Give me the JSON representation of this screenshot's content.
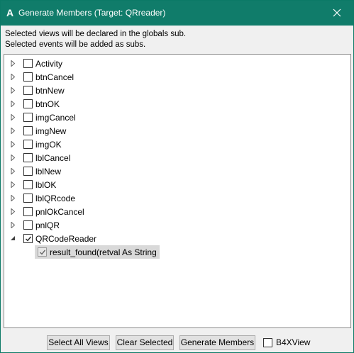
{
  "window": {
    "title": "Generate Members (Target: QRreader)",
    "icon_letter": "A",
    "titlebar_color": "#107c6a"
  },
  "description": {
    "line1": "Selected views will be declared in the globals sub.",
    "line2": "Selected events will be added as subs."
  },
  "tree": {
    "items": [
      {
        "label": "Activity",
        "checked": false,
        "expanded": false
      },
      {
        "label": "btnCancel",
        "checked": false,
        "expanded": false
      },
      {
        "label": "btnNew",
        "checked": false,
        "expanded": false
      },
      {
        "label": "btnOK",
        "checked": false,
        "expanded": false
      },
      {
        "label": "imgCancel",
        "checked": false,
        "expanded": false
      },
      {
        "label": "imgNew",
        "checked": false,
        "expanded": false
      },
      {
        "label": "imgOK",
        "checked": false,
        "expanded": false
      },
      {
        "label": "lblCancel",
        "checked": false,
        "expanded": false
      },
      {
        "label": "lblNew",
        "checked": false,
        "expanded": false
      },
      {
        "label": "lblOK",
        "checked": false,
        "expanded": false
      },
      {
        "label": "lblQRcode",
        "checked": false,
        "expanded": false
      },
      {
        "label": "pnlOkCancel",
        "checked": false,
        "expanded": false
      },
      {
        "label": "pnlQR",
        "checked": false,
        "expanded": false
      },
      {
        "label": "QRCodeReader",
        "checked": true,
        "expanded": true
      }
    ],
    "child": {
      "label": "result_found(retval As String",
      "checked": true
    }
  },
  "buttons": {
    "select_all_views": "Select All Views",
    "clear_selected": "Clear Selected",
    "generate_members": "Generate Members"
  },
  "b4xview": {
    "label": "B4XView",
    "checked": false
  }
}
